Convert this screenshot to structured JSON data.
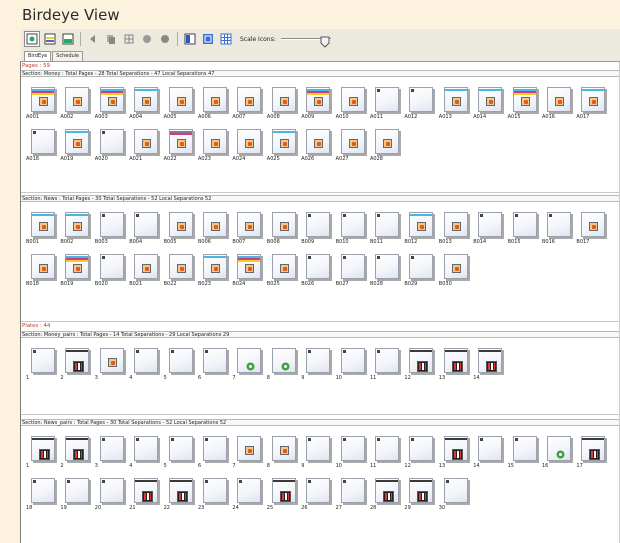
{
  "app": {
    "title": "Birdeye View"
  },
  "toolbar": {
    "buttons": [
      {
        "name": "view-mode-icon"
      },
      {
        "name": "separations-icon"
      },
      {
        "name": "plates-icon"
      },
      {
        "name": "back-icon"
      },
      {
        "name": "copy-icon"
      },
      {
        "name": "grid-icon"
      },
      {
        "name": "circle-icon"
      },
      {
        "name": "circle-alt-icon"
      },
      {
        "name": "layout-icon"
      },
      {
        "name": "arrange-icon"
      },
      {
        "name": "table-icon"
      }
    ],
    "scale_label": "Scale Icons:",
    "scale_level_percent": 85
  },
  "tabs": [
    {
      "label": "BirdEye",
      "active": true
    },
    {
      "label": "Schedule",
      "active": false
    }
  ],
  "pages_count": "Pages : 59",
  "plates_count": "Plates : 44",
  "sections": [
    {
      "header": "Section: Money : Total Pages - 28   Total Separations - 47 Local Separations 47"
    },
    {
      "header": "Section: News : Total Pages - 30   Total Separations - 52 Local Separations 52"
    },
    {
      "header": "Section: Money_pairs : Total Pages - 14   Total Separations - 29 Local Separations 29"
    },
    {
      "header": "Section: News_pairs : Total Pages - 30   Total Separations - 52 Local Separations 52"
    }
  ],
  "money_items": [
    "A001",
    "A002",
    "A003",
    "A004",
    "A005",
    "A006",
    "A007",
    "A008",
    "A009",
    "A010",
    "A011",
    "A012",
    "A013",
    "A014",
    "A015",
    "A016",
    "A017",
    "A018",
    "A019",
    "A020",
    "A021",
    "A022",
    "A023",
    "A024",
    "A025",
    "A026",
    "A027",
    "A028"
  ],
  "news_items": [
    "B001",
    "B002",
    "B003",
    "B004",
    "B005",
    "B006",
    "B007",
    "B008",
    "B009",
    "B010",
    "B011",
    "B012",
    "B013",
    "B014",
    "B015",
    "B016",
    "B017",
    "B018",
    "B019",
    "B020",
    "B021",
    "B022",
    "B023",
    "B024",
    "B025",
    "B026",
    "B027",
    "B028",
    "B029",
    "B030"
  ],
  "money_pairs_items": [
    "1",
    "2",
    "3",
    "4",
    "5",
    "6",
    "7",
    "8",
    "9",
    "10",
    "11",
    "12",
    "13",
    "14"
  ],
  "news_pairs_items": [
    "1",
    "2",
    "3",
    "4",
    "5",
    "6",
    "7",
    "8",
    "9",
    "10",
    "11",
    "12",
    "13",
    "14",
    "15",
    "16",
    "17",
    "18",
    "19",
    "20",
    "21",
    "22",
    "23",
    "24",
    "25",
    "26",
    "27",
    "28",
    "29",
    "30"
  ],
  "colors": {
    "cyan": "#49b8e0",
    "magenta": "#d4398f",
    "yellow": "#f2d21a",
    "black": "#3a3a3a",
    "gray": "#7f7f7f",
    "red": "#d42a1e"
  }
}
